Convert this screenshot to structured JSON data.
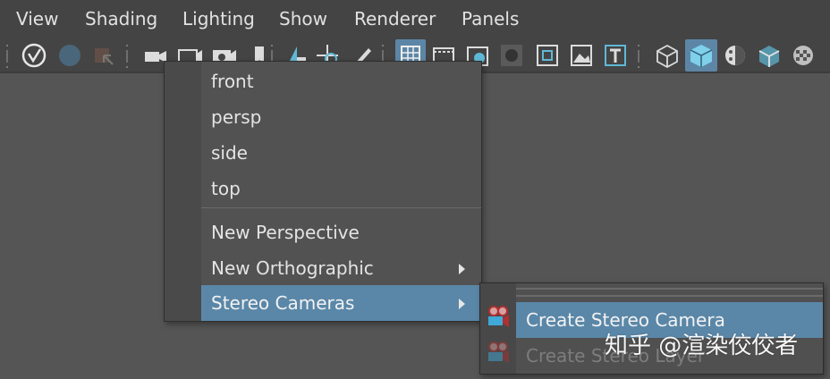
{
  "menubar": {
    "items": [
      "View",
      "Shading",
      "Lighting",
      "Show",
      "Renderer",
      "Panels"
    ]
  },
  "camera_menu": {
    "cameras": [
      "front",
      "persp",
      "side",
      "top"
    ],
    "actions": [
      {
        "label": "New Perspective",
        "has_submenu": false
      },
      {
        "label": "New Orthographic",
        "has_submenu": true
      },
      {
        "label": "Stereo Cameras",
        "has_submenu": true,
        "highlighted": true
      }
    ]
  },
  "stereo_menu": {
    "items": [
      {
        "label": "Create Stereo Camera",
        "highlighted": true,
        "enabled": true
      },
      {
        "label": "Create Stereo Layer",
        "highlighted": false,
        "enabled": false
      }
    ]
  },
  "watermark": "知乎 @渲染佼佼者",
  "colors": {
    "background": "#444444",
    "viewport": "#555555",
    "highlight": "#5a87a8",
    "toolbar_active": "#5d86a6"
  }
}
